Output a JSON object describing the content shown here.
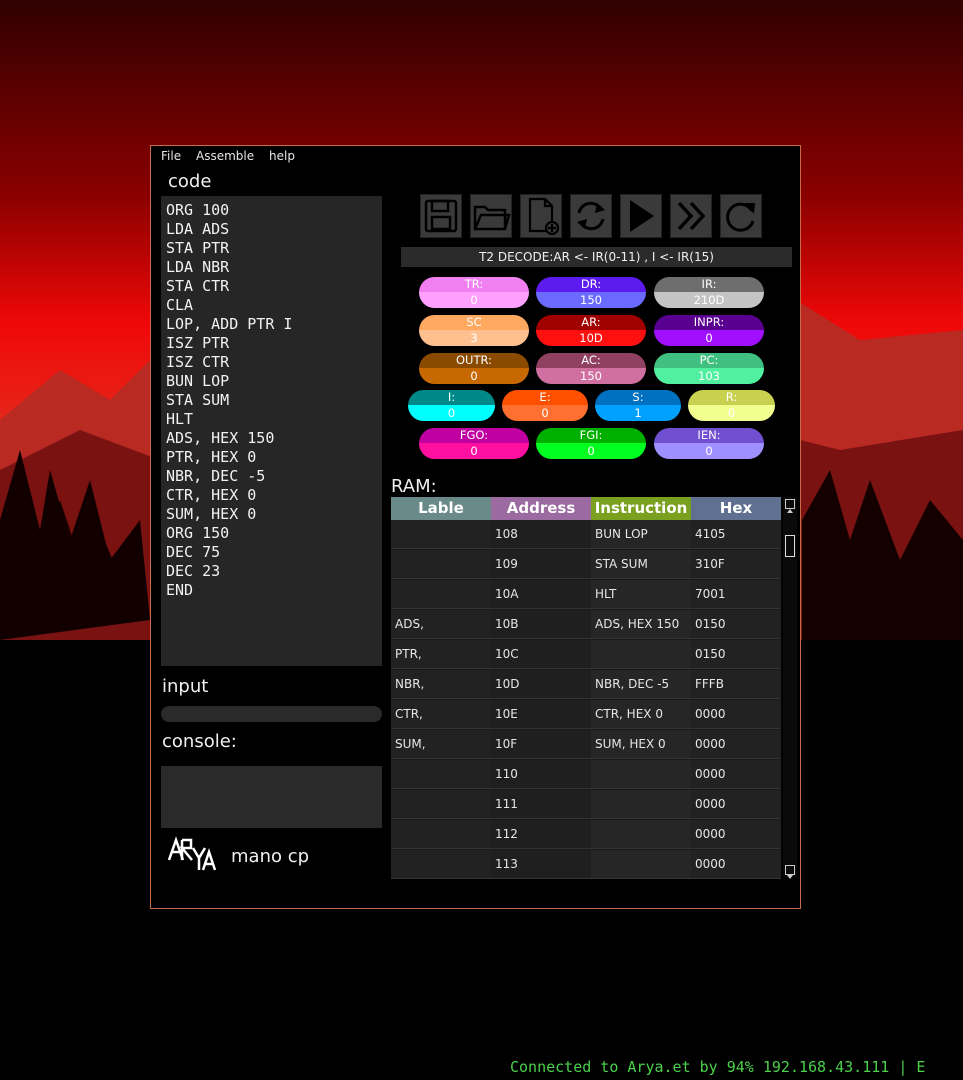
{
  "menu": [
    "File",
    "Assemble",
    "help"
  ],
  "labels": {
    "code": "code",
    "input": "input",
    "console": "console:",
    "ram": "RAM:"
  },
  "app_name": "mano cp",
  "logo_text": "ARYA",
  "code_lines": [
    "ORG 100",
    "LDA ADS",
    "STA PTR",
    "LDA NBR",
    "STA CTR",
    "CLA",
    "LOP, ADD PTR I",
    "ISZ PTR",
    "ISZ CTR",
    "BUN LOP",
    "STA SUM",
    "HLT",
    "ADS, HEX 150",
    "PTR, HEX 0",
    "NBR, DEC -5",
    "CTR, HEX 0",
    "SUM, HEX 0",
    "ORG 150",
    "DEC 75",
    "DEC 23",
    "END"
  ],
  "toolbar_icons": [
    "save-icon",
    "open-folder-icon",
    "new-file-icon",
    "refresh-icon",
    "play-icon",
    "fast-forward-icon",
    "reset-icon"
  ],
  "status": "T2 DECODE:AR <- IR(0-11) , I <- IR(15)",
  "registers": [
    {
      "name": "TR:",
      "value": "0",
      "top": "#f080f0",
      "bot": "#ffa0ff"
    },
    {
      "name": "DR:",
      "value": "150",
      "top": "#5c1cf0",
      "bot": "#6a6aff"
    },
    {
      "name": "IR:",
      "value": "210D",
      "top": "#6e6e6e",
      "bot": "#c4c4c4"
    },
    {
      "name": "SC",
      "value": "3",
      "top": "#ffa860",
      "bot": "#ffc090"
    },
    {
      "name": "AR:",
      "value": "10D",
      "top": "#a00000",
      "bot": "#ff1010"
    },
    {
      "name": "INPR:",
      "value": "0",
      "top": "#5a0090",
      "bot": "#a010ff"
    },
    {
      "name": "OUTR:",
      "value": "0",
      "top": "#8a4a00",
      "bot": "#c86800"
    },
    {
      "name": "AC:",
      "value": "150",
      "top": "#904060",
      "bot": "#d070a0"
    },
    {
      "name": "PC:",
      "value": "103",
      "top": "#40c080",
      "bot": "#50f0a0"
    },
    {
      "name": "I:",
      "value": "0",
      "top": "#008888",
      "bot": "#00ffff"
    },
    {
      "name": "E:",
      "value": "0",
      "top": "#ff5000",
      "bot": "#ff7030"
    },
    {
      "name": "S:",
      "value": "1",
      "top": "#0070c0",
      "bot": "#00a0ff"
    },
    {
      "name": "R:",
      "value": "0",
      "top": "#c8d050",
      "bot": "#f0ff90"
    },
    {
      "name": "FGO:",
      "value": "0",
      "top": "#c000a0",
      "bot": "#ff10a0"
    },
    {
      "name": "FGI:",
      "value": "0",
      "top": "#00b000",
      "bot": "#00ff20"
    },
    {
      "name": "IEN:",
      "value": "0",
      "top": "#7050d0",
      "bot": "#a090ff"
    }
  ],
  "ram": {
    "headers": [
      {
        "label": "Lable",
        "color": "#6a8a8a"
      },
      {
        "label": "Address",
        "color": "#9a6aa0"
      },
      {
        "label": "Instruction",
        "color": "#7aa020"
      },
      {
        "label": "Hex",
        "color": "#607090"
      }
    ],
    "rows": [
      [
        "",
        "108",
        "BUN LOP",
        "4105"
      ],
      [
        "",
        "109",
        "STA SUM",
        "310F"
      ],
      [
        "",
        "10A",
        "HLT",
        "7001"
      ],
      [
        "ADS,",
        "10B",
        "ADS, HEX 150",
        "0150"
      ],
      [
        "PTR,",
        "10C",
        "",
        "0150"
      ],
      [
        "NBR,",
        "10D",
        "NBR, DEC -5",
        "FFFB"
      ],
      [
        "CTR,",
        "10E",
        "CTR, HEX 0",
        "0000"
      ],
      [
        "SUM,",
        "10F",
        "SUM, HEX 0",
        "0000"
      ],
      [
        "",
        "110",
        "",
        "0000"
      ],
      [
        "",
        "111",
        "",
        "0000"
      ],
      [
        "",
        "112",
        "",
        "0000"
      ],
      [
        "",
        "113",
        "",
        "0000"
      ]
    ]
  },
  "statusbar": "Connected to Arya.et by 94% 192.168.43.111 | E"
}
